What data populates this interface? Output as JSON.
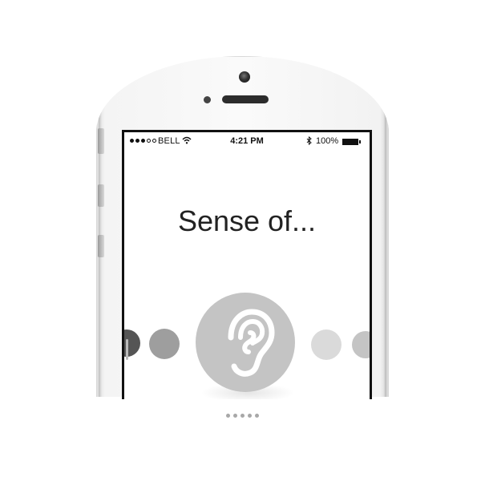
{
  "status_bar": {
    "carrier": "BELL",
    "time": "4:21 PM",
    "battery": "100%",
    "signal_bars_filled": 3,
    "signal_bars_total": 5
  },
  "screen": {
    "headline": "Sense of..."
  },
  "carousel": {
    "selected_item": "ear-icon",
    "items": [
      "dot-dark",
      "dot-mid",
      "ear-icon",
      "dot-light",
      "dot-light-edge"
    ]
  },
  "pager": {
    "count": 5
  },
  "colors": {
    "screen_bg": "#ffffff",
    "bezel": "#111111",
    "selected_circle": "#c4c4c4",
    "dot_dark": "#555555",
    "dot_mid": "#9e9e9e",
    "dot_light": "#dadada",
    "dot_edge": "#c4c4c4"
  }
}
